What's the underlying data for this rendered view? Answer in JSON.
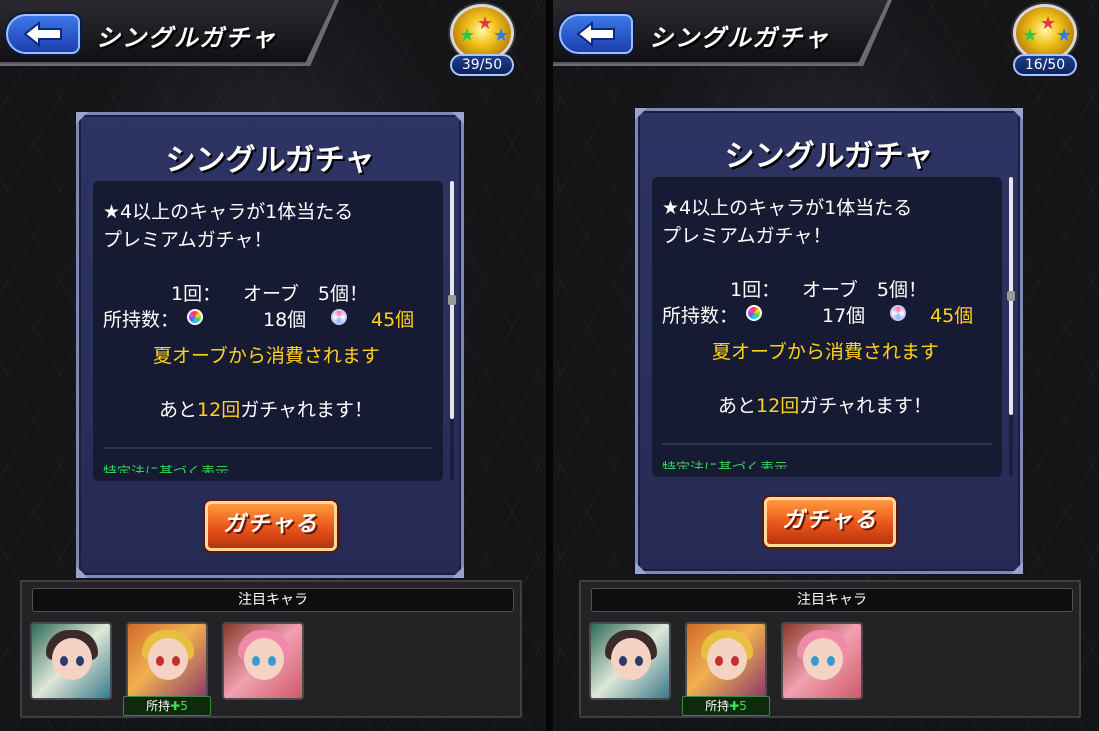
{
  "screens": [
    {
      "header": {
        "title": "シングルガチャ",
        "back_icon": "back-arrow-icon"
      },
      "stamina": {
        "count": "39/50"
      },
      "window": {
        "title": "シングルガチャ",
        "desc_line1": "★4以上のキャラが1体当たる",
        "desc_line2": "プレミアムガチャ！",
        "cost_label": "1回：",
        "cost_value": "オーブ　5個！",
        "owned_label": "所持数：",
        "orb_count": "18個",
        "summer_orb_count": "45個",
        "consume_note": "夏オーブから消費されます",
        "remaining_prefix": "あと",
        "remaining_count": "12回",
        "remaining_suffix": "ガチャれます！",
        "cut_text": "特定法に基づく表示",
        "gacha_button": "ガチャる"
      },
      "featured": {
        "title": "注目キャラ",
        "owned_label": "所持",
        "owned_count": "5"
      }
    },
    {
      "header": {
        "title": "シングルガチャ",
        "back_icon": "back-arrow-icon"
      },
      "stamina": {
        "count": "16/50"
      },
      "window": {
        "title": "シングルガチャ",
        "desc_line1": "★4以上のキャラが1体当たる",
        "desc_line2": "プレミアムガチャ！",
        "cost_label": "1回：",
        "cost_value": "オーブ　5個！",
        "owned_label": "所持数：",
        "orb_count": "17個",
        "summer_orb_count": "45個",
        "consume_note": "夏オーブから消費されます",
        "remaining_prefix": "あと",
        "remaining_count": "12回",
        "remaining_suffix": "ガチャれます！",
        "cut_text": "特定法に基づく表示",
        "gacha_button": "ガチャる"
      },
      "featured": {
        "title": "注目キャラ",
        "owned_label": "所持",
        "owned_count": "5"
      }
    }
  ],
  "colors": {
    "accent_yellow": "#ffd21a",
    "window_bg": "#2e3463",
    "gacha_orange": "#e8541a",
    "back_blue": "#3d77e8"
  }
}
